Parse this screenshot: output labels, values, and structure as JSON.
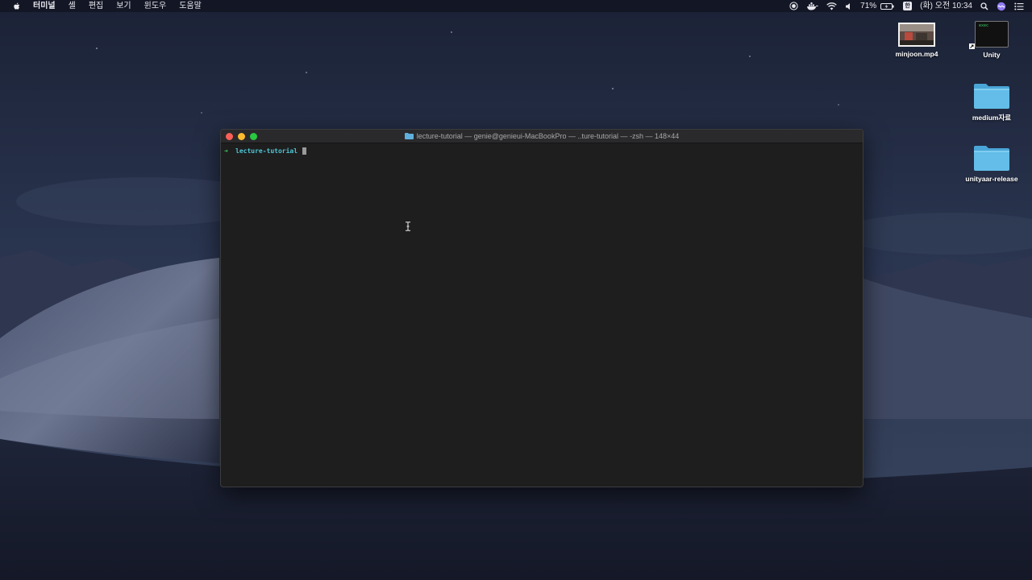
{
  "menubar": {
    "apple_icon": "apple-logo-icon",
    "items": [
      "터미널",
      "셸",
      "편집",
      "보기",
      "윈도우",
      "도움말"
    ],
    "battery": "71%",
    "input_indicator": "한",
    "clock": "(화) 오전 10:34",
    "status_icons": [
      "screen-record-icon",
      "docker-icon",
      "wifi-icon",
      "volume-icon",
      "battery-icon",
      "input-source-icon",
      "spotlight-icon",
      "siri-icon",
      "notification-center-icon"
    ]
  },
  "desktop_icons": [
    {
      "label": "minjoon.mp4",
      "icon": "video-thumbnail-icon"
    },
    {
      "label": "Unity",
      "icon": "exec-file-icon",
      "thumb_text": "exec"
    },
    {
      "label": "medium자료",
      "icon": "folder-icon"
    },
    {
      "label": "unityaar-release",
      "icon": "folder-icon"
    }
  ],
  "terminal": {
    "title": "lecture-tutorial — genie@genieui-MacBookPro — ..ture-tutorial — -zsh — 148×44",
    "prompt_arrow": "➜",
    "prompt_dir": "lecture-tutorial",
    "colors": {
      "arrow": "#3fcb6a",
      "directory": "#4fc7d8",
      "background": "#1e1e1e"
    }
  }
}
